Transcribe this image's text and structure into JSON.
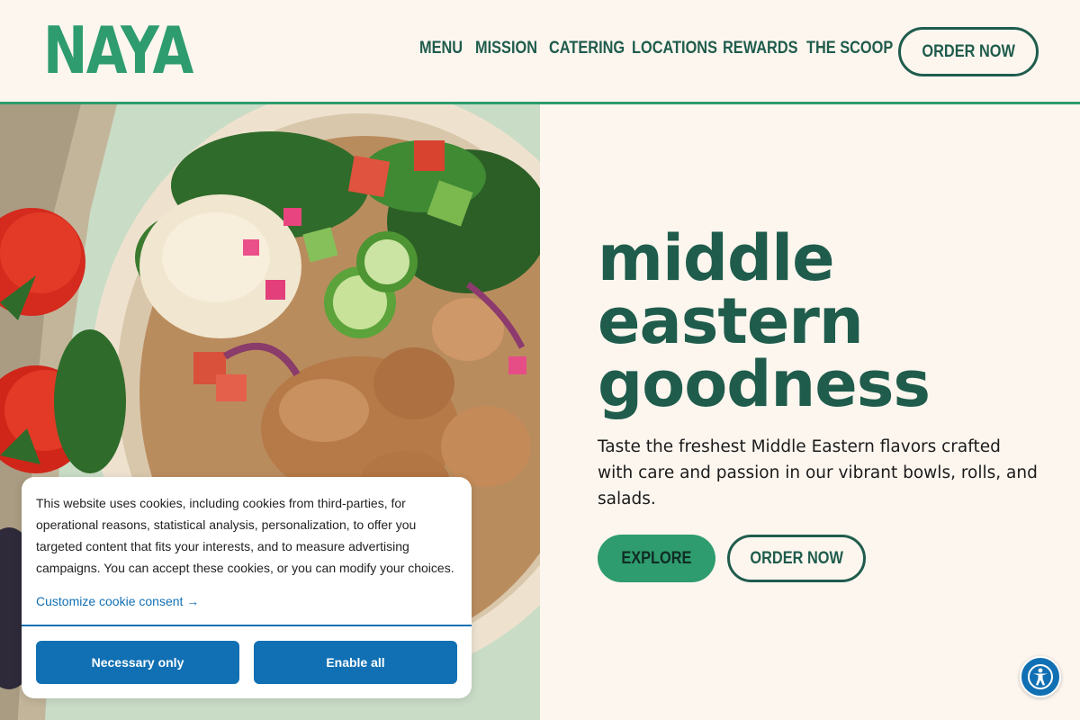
{
  "header": {
    "logo": "NAYA",
    "nav": [
      "MENU",
      "MISSION",
      "CATERING",
      "LOCATIONS",
      "REWARDS",
      "THE SCOOP"
    ],
    "order_now": "ORDER NOW"
  },
  "hero": {
    "title_lines": [
      "middle",
      "eastern",
      "goodness"
    ],
    "description": "Taste the freshest Middle Eastern flavors crafted with care and passion in our vibrant bowls, rolls, and salads.",
    "explore": "EXPLORE",
    "order_now": "ORDER NOW",
    "image_icon": "food-bowl-image"
  },
  "cookie": {
    "text": "This website uses cookies, including cookies from third-parties, for operational reasons, statistical analysis, personalization, to offer you targeted content that fits your interests, and to measure advertising campaigns. You can accept these cookies, or you can modify your choices.",
    "customize": "Customize cookie consent →",
    "necessary_only": "Necessary only",
    "enable_all": "Enable all"
  },
  "accessibility": {
    "icon": "accessibility-icon"
  },
  "colors": {
    "brand_green": "#2e9c6e",
    "dark_green": "#1f5c4c",
    "cream": "#fdf6ef",
    "cookie_blue": "#1170b3"
  }
}
